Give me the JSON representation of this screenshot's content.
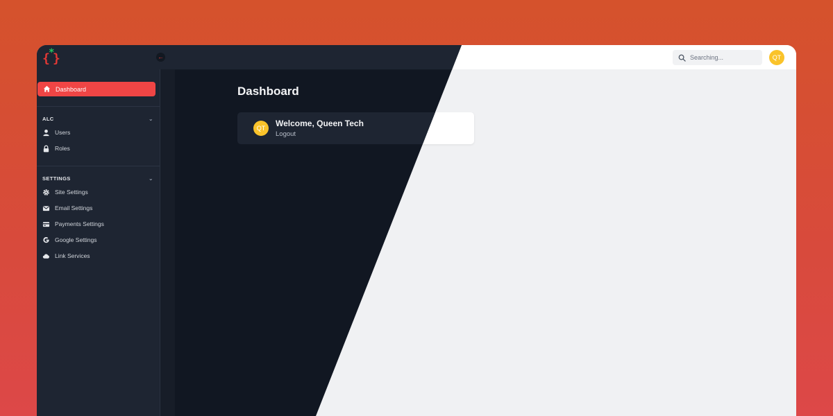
{
  "brand": {
    "logo_icon": "curly-braces-asterisk-logo"
  },
  "colors": {
    "accent": "#f04545",
    "avatar": "#fac32a",
    "dark_bg": "#111722",
    "sidebar_bg": "#1e2532"
  },
  "search": {
    "placeholder": "Searching..."
  },
  "user": {
    "initials": "QT"
  },
  "sidebar": {
    "active": {
      "label": "Dashboard",
      "icon": "home-icon"
    },
    "sections": [
      {
        "heading": "ALC",
        "items": [
          {
            "label": "Users",
            "icon": "user-icon"
          },
          {
            "label": "Roles",
            "icon": "lock-icon"
          }
        ]
      },
      {
        "heading": "SETTINGS",
        "items": [
          {
            "label": "Site Settings",
            "icon": "gear-icon"
          },
          {
            "label": "Email Settings",
            "icon": "envelope-icon"
          },
          {
            "label": "Payments Settings",
            "icon": "credit-card-icon"
          },
          {
            "label": "Google Settings",
            "icon": "google-icon"
          },
          {
            "label": "Link Services",
            "icon": "cloud-icon"
          }
        ]
      }
    ]
  },
  "main": {
    "title": "Dashboard",
    "card": {
      "initials": "QT",
      "welcome": "Welcome, Queen Tech",
      "logout": "Logout"
    }
  }
}
